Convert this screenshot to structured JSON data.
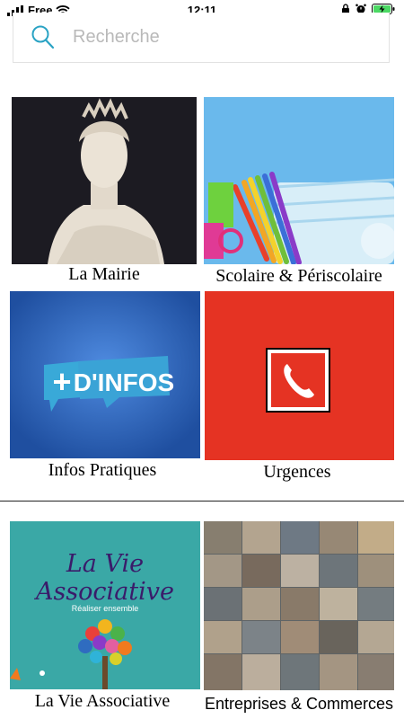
{
  "status_bar": {
    "carrier": "Free",
    "time": "12:11"
  },
  "search": {
    "placeholder": "Recherche"
  },
  "tiles": [
    {
      "label": "La Mairie"
    },
    {
      "label": "Scolaire & Périscolaire"
    },
    {
      "label": "Infos Pratiques",
      "image_text": "+ D'INFOS"
    },
    {
      "label": "Urgences"
    },
    {
      "label": "La Vie Associative",
      "image_title": "La Vie Associative",
      "image_subtitle": "Réaliser ensemble"
    },
    {
      "label": "Entreprises & Commerces"
    }
  ],
  "colors": {
    "urgences_red": "#e53323",
    "infos_blue": "#2f6cc0",
    "associative_teal": "#3aa8a6",
    "title_purple": "#3a1b6a"
  }
}
